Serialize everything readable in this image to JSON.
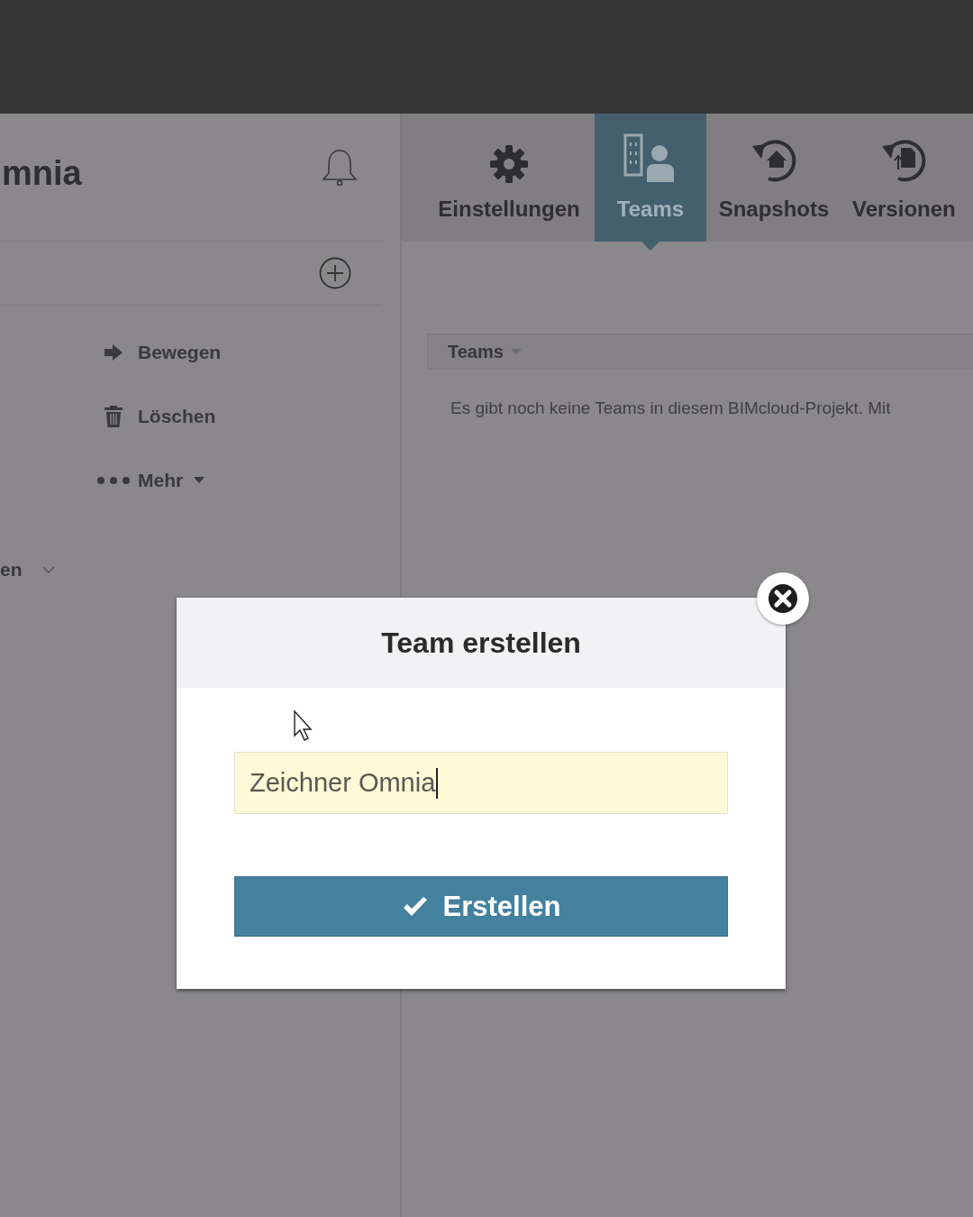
{
  "header": {
    "title": "mnia"
  },
  "sidebar": {
    "actions": [
      {
        "kind": "move",
        "label": "Bewegen"
      },
      {
        "kind": "delete",
        "label": "Löschen"
      },
      {
        "kind": "more",
        "label": "Mehr"
      }
    ],
    "section_label": "en"
  },
  "tabs": [
    {
      "kind": "settings",
      "label": "Einstellungen",
      "selected": false
    },
    {
      "kind": "teams",
      "label": "Teams",
      "selected": true
    },
    {
      "kind": "snapshots",
      "label": "Snapshots",
      "selected": false
    },
    {
      "kind": "versions",
      "label": "Versionen",
      "selected": false
    }
  ],
  "teams_table": {
    "column_header": "Teams",
    "empty_message": "Es gibt noch keine Teams in diesem BIMcloud-Projekt. Mit"
  },
  "dialog": {
    "title": "Team erstellen",
    "input": {
      "value": "Zeichner Omnia"
    },
    "button": "Erstellen"
  }
}
